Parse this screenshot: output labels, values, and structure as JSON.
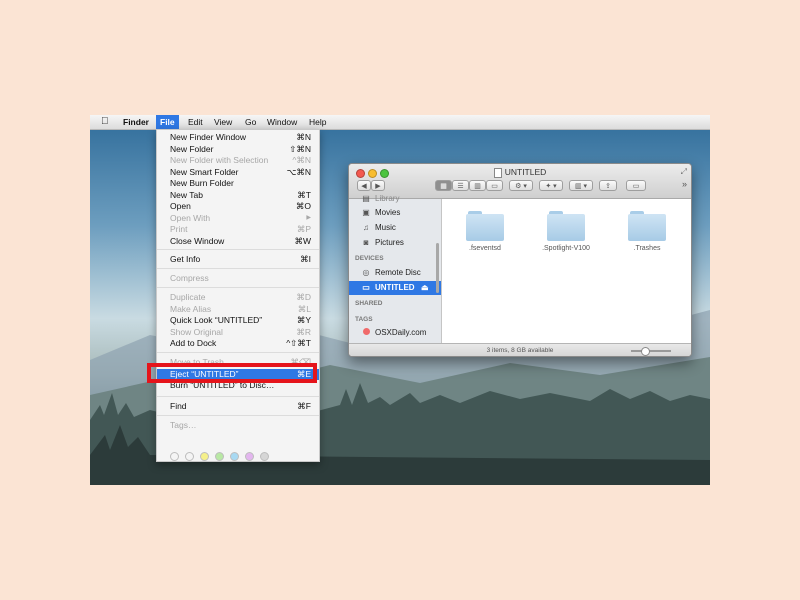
{
  "menubar": {
    "apple": "",
    "items": [
      "Finder",
      "File",
      "Edit",
      "View",
      "Go",
      "Window",
      "Help"
    ]
  },
  "file_menu": {
    "items": [
      {
        "label": "New Finder Window",
        "shortcut": "⌘N"
      },
      {
        "label": "New Folder",
        "shortcut": "⇧⌘N"
      },
      {
        "label": "New Folder with Selection",
        "shortcut": "^⌘N"
      },
      {
        "label": "New Smart Folder",
        "shortcut": "⌥⌘N"
      },
      {
        "label": "New Burn Folder",
        "shortcut": ""
      },
      {
        "label": "New Tab",
        "shortcut": "⌘T"
      },
      {
        "label": "Open",
        "shortcut": "⌘O"
      },
      {
        "label": "Open With",
        "shortcut": "▶"
      },
      {
        "label": "Print",
        "shortcut": "⌘P"
      },
      {
        "label": "Close Window",
        "shortcut": "⌘W"
      },
      {
        "label": "Get Info",
        "shortcut": "⌘I"
      },
      {
        "label": "Compress",
        "shortcut": ""
      },
      {
        "label": "Duplicate",
        "shortcut": "⌘D"
      },
      {
        "label": "Make Alias",
        "shortcut": "⌘L"
      },
      {
        "label": "Quick Look “UNTITLED”",
        "shortcut": "⌘Y"
      },
      {
        "label": "Show Original",
        "shortcut": "⌘R"
      },
      {
        "label": "Add to Dock",
        "shortcut": "^⇧⌘T"
      },
      {
        "label": "Move to Trash",
        "shortcut": "⌘⌫"
      },
      {
        "label": "Eject “UNTITLED”",
        "shortcut": "⌘E"
      },
      {
        "label": "Burn “UNTITLED” to Disc…",
        "shortcut": ""
      },
      {
        "label": "Find",
        "shortcut": "⌘F"
      },
      {
        "label": "Tags…",
        "shortcut": ""
      }
    ],
    "tag_colors": [
      "#ffffff",
      "#ffffff",
      "#f5f08a",
      "#b8e8a4",
      "#a8d9f2",
      "#e3b6ef",
      "#d6d6d6"
    ]
  },
  "finder_window": {
    "title": "UNTITLED",
    "toolbar": {
      "back": "◀",
      "forward": "▶",
      "more": "»"
    },
    "sidebar": {
      "items_top": [
        {
          "label": "Library",
          "icon": "library-icon"
        },
        {
          "label": "Movies",
          "icon": "film-icon"
        },
        {
          "label": "Music",
          "icon": "music-note-icon"
        },
        {
          "label": "Pictures",
          "icon": "camera-icon"
        }
      ],
      "devices_header": "DEVICES",
      "devices": [
        {
          "label": "Remote Disc",
          "icon": "disc-icon"
        },
        {
          "label": "UNTITLED",
          "icon": "drive-icon",
          "eject": "⏏"
        }
      ],
      "shared_header": "SHARED",
      "tags_header": "TAGS",
      "tags": [
        {
          "label": "OSXDaily.com",
          "color": "#f06a6a"
        }
      ]
    },
    "files": [
      ".fseventsd",
      ".Spotlight-V100",
      ".Trashes"
    ],
    "status": "3 items, 8 GB available"
  },
  "colors": {
    "accent": "#2f78e4",
    "highlight_box": "#e5141b",
    "background": "#fbe4d4"
  }
}
